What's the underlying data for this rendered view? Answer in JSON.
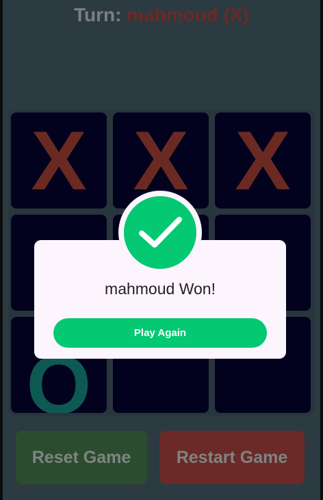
{
  "header": {
    "turn_label": "Turn:",
    "current_player": "mahmoud (X)"
  },
  "board": {
    "cells": [
      "X",
      "X",
      "X",
      "",
      "",
      "",
      "O",
      "",
      ""
    ]
  },
  "controls": {
    "reset_label": "Reset Game",
    "restart_label": "Restart Game"
  },
  "dialog": {
    "icon": "checkmark-icon",
    "message": "mahmoud Won!",
    "button_label": "Play Again"
  },
  "colors": {
    "background": "#2c3a42",
    "cell": "#02021f",
    "x_mark": "#6a2a22",
    "o_mark": "#0e5a52",
    "success": "#05c872",
    "reset_button": "#2c4c2f",
    "restart_button": "#6b2a28",
    "dialog": "#fcf5fd"
  }
}
